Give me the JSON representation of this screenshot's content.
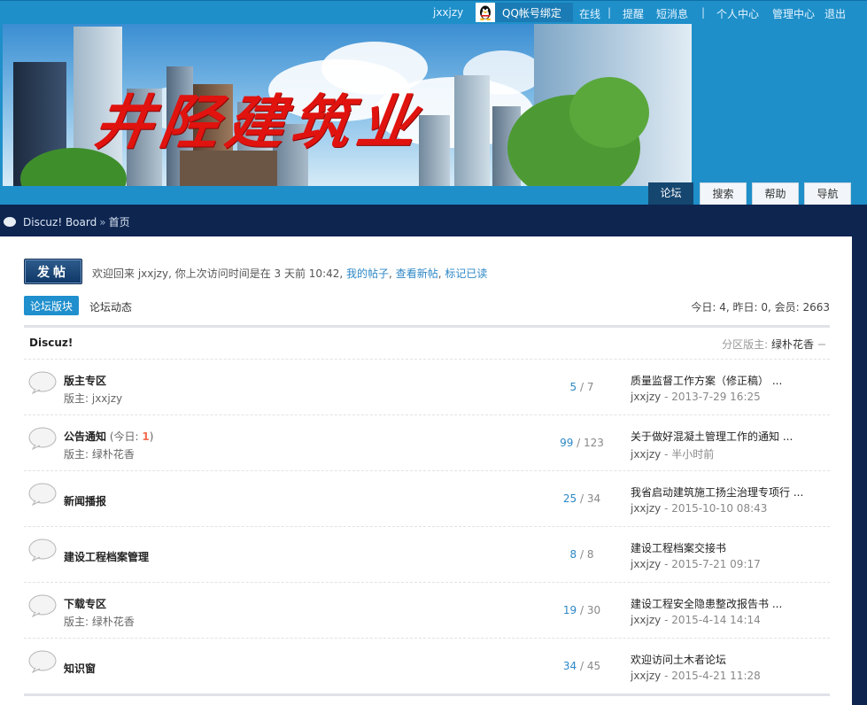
{
  "topbar": {
    "username": "jxxjzy",
    "qq_bind": "QQ帐号绑定",
    "online": "在线",
    "sep": "|",
    "remind": "提醒",
    "pm": "短消息",
    "profile": "个人中心",
    "admin": "管理中心",
    "logout": "退出"
  },
  "banner": {
    "calligraphy": "井陉建筑业"
  },
  "nav": {
    "tabs": [
      "论坛",
      "搜索",
      "帮助",
      "导航"
    ]
  },
  "breadcrumb": {
    "board": "Discuz! Board",
    "sep": "»",
    "home": "首页"
  },
  "main": {
    "post_button": "发帖",
    "welcome_prefix": "欢迎回来 jxxjzy, 你上次访问时间是在 3 天前 10:42,",
    "links": [
      "我的帖子",
      "查看新帖",
      "标记已读"
    ],
    "tabs": [
      "论坛版块",
      "论坛动态"
    ],
    "stats": "今日: 4, 昨日: 0, 会员: 2663"
  },
  "category": {
    "title": "Discuz!",
    "moderator_label": "分区版主:",
    "moderator": "绿朴花香"
  },
  "forums": [
    {
      "name": "版主专区",
      "today_prefix": "",
      "today_num": "",
      "today_suffix": "",
      "moderator": "版主: jxxjzy",
      "threads": "5",
      "posts": "/ 7",
      "last_title": "质量监督工作方案（修正稿） ...",
      "last_user": "jxxjzy",
      "last_time": "- 2013-7-29 16:25"
    },
    {
      "name": "公告通知",
      "today_prefix": " (今日: ",
      "today_num": "1",
      "today_suffix": ")",
      "moderator": "版主: 绿朴花香",
      "threads": "99",
      "posts": "/ 123",
      "last_title": "关于做好混凝土管理工作的通知 ...",
      "last_user": "jxxjzy",
      "last_time": "- 半小时前"
    },
    {
      "name": "新闻播报",
      "today_prefix": "",
      "today_num": "",
      "today_suffix": "",
      "moderator": "",
      "threads": "25",
      "posts": "/ 34",
      "last_title": "我省启动建筑施工扬尘治理专项行 ...",
      "last_user": "jxxjzy",
      "last_time": "- 2015-10-10 08:43"
    },
    {
      "name": "建设工程档案管理",
      "today_prefix": "",
      "today_num": "",
      "today_suffix": "",
      "moderator": "",
      "threads": "8",
      "posts": "/ 8",
      "last_title": "建设工程档案交接书",
      "last_user": "jxxjzy",
      "last_time": "- 2015-7-21 09:17"
    },
    {
      "name": "下载专区",
      "today_prefix": "",
      "today_num": "",
      "today_suffix": "",
      "moderator": "版主: 绿朴花香",
      "threads": "19",
      "posts": "/ 30",
      "last_title": "建设工程安全隐患整改报告书 ...",
      "last_user": "jxxjzy",
      "last_time": "- 2015-4-14 14:14"
    },
    {
      "name": "知识窗",
      "today_prefix": "",
      "today_num": "",
      "today_suffix": "",
      "moderator": "",
      "threads": "34",
      "posts": "/ 45",
      "last_title": "欢迎访问土木者论坛",
      "last_user": "jxxjzy",
      "last_time": "- 2015-4-21 11:28"
    }
  ]
}
